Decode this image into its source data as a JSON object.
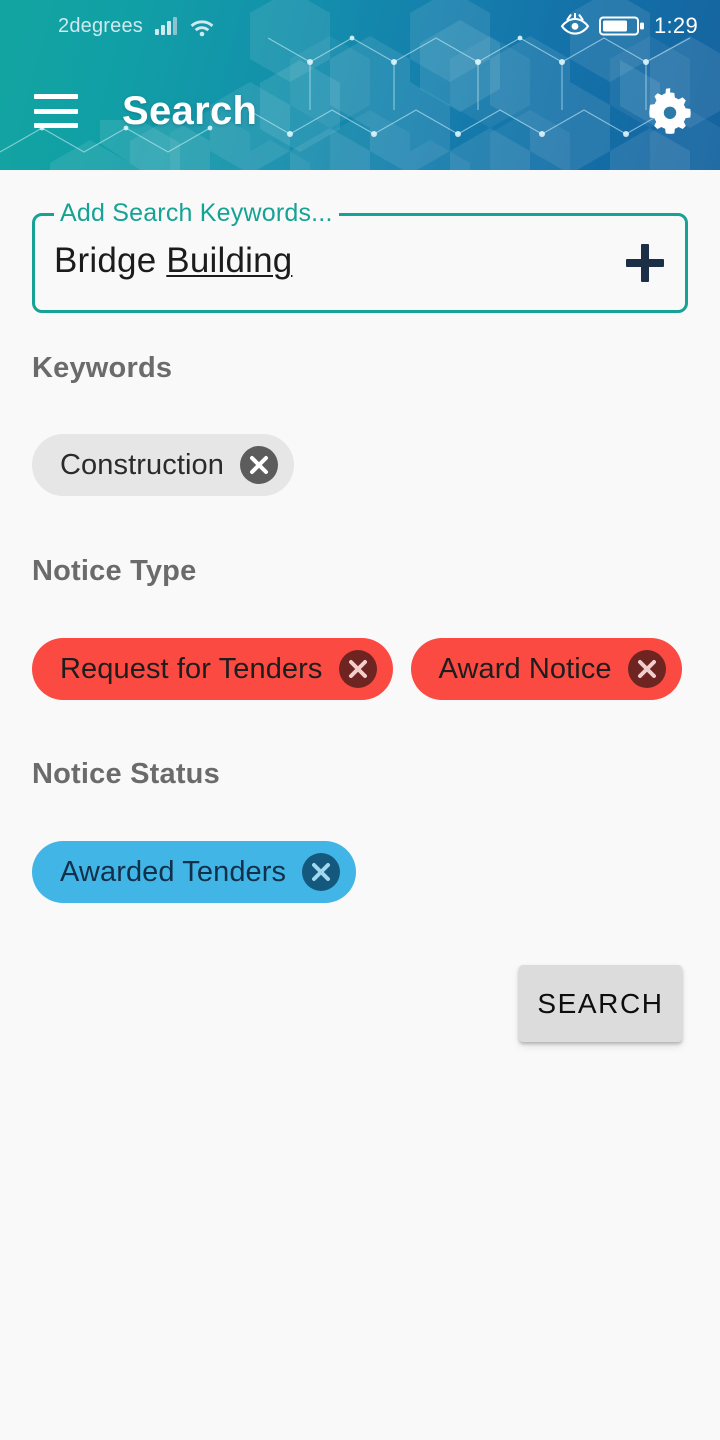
{
  "statusbar": {
    "carrier": "2degrees",
    "time": "1:29",
    "icons": [
      "signal-bars-icon",
      "wifi-icon",
      "eye-comfort-icon",
      "battery-icon"
    ],
    "battery_level_percent": 70
  },
  "appbar": {
    "menu_icon": "hamburger-menu-icon",
    "title": "Search",
    "settings_icon": "gear-icon"
  },
  "search_field": {
    "label": "Add Search Keywords...",
    "value": "Bridge ",
    "value_misspelled_part": "Building",
    "add_icon": "plus-icon"
  },
  "sections": [
    {
      "title": "Keywords",
      "chips": [
        {
          "label": "Construction",
          "style": "gray",
          "remove_icon": "close-circle-icon"
        }
      ]
    },
    {
      "title": "Notice Type",
      "chips": [
        {
          "label": "Request for Tenders",
          "style": "red",
          "remove_icon": "close-circle-icon"
        },
        {
          "label": "Award Notice",
          "style": "red",
          "remove_icon": "close-circle-icon"
        }
      ]
    },
    {
      "title": "Notice Status",
      "chips": [
        {
          "label": "Awarded Tenders",
          "style": "blue",
          "remove_icon": "close-circle-icon"
        }
      ]
    }
  ],
  "search_button": {
    "label": "SEARCH"
  },
  "colors": {
    "header_gradient_start": "#12a5a0",
    "header_gradient_end": "#15639f",
    "accent_teal": "#16a294",
    "chip_red": "#fb4a42",
    "chip_blue": "#41b6e6",
    "chip_gray": "#e6e6e6",
    "page_background": "#f9f9f9",
    "section_title": "#6b6b6b",
    "button_gray": "#dcdcdc"
  }
}
